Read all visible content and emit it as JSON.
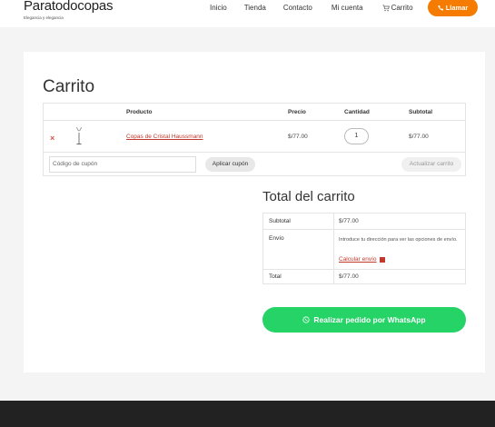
{
  "header": {
    "site_title": "Paratodocopas",
    "tagline": "Elegancia y elegancia",
    "nav": [
      "Inicio",
      "Tienda",
      "Contacto",
      "Mi cuenta"
    ],
    "cart_label": "Carrito",
    "call_label": "Llamar",
    "call_color": "#f57c00"
  },
  "cart": {
    "page_title": "Carrito",
    "columns": [
      "Producto",
      "Precio",
      "Cantidad",
      "Subtotal"
    ],
    "items": [
      {
        "remove": "×",
        "product": "Copas de Cristal Haussmann",
        "price": "$/77.00",
        "quantity": "1",
        "subtotal": "$/77.00"
      }
    ],
    "coupon_placeholder": "Código de cupón",
    "apply_coupon": "Aplicar cupón",
    "update_cart": "Actualizar carrito"
  },
  "totals": {
    "title": "Total del carrito",
    "subtotal_label": "Subtotal",
    "subtotal_value": "$/77.00",
    "shipping_label": "Envío",
    "shipping_note": "Introduce tu dirección para ver las opciones de envío.",
    "calc_shipping": "Calcular envío",
    "total_label": "Total",
    "total_value": "$/77.00"
  },
  "whatsapp": {
    "label": "Realizar pedido por WhatsApp",
    "color": "#25d366"
  }
}
